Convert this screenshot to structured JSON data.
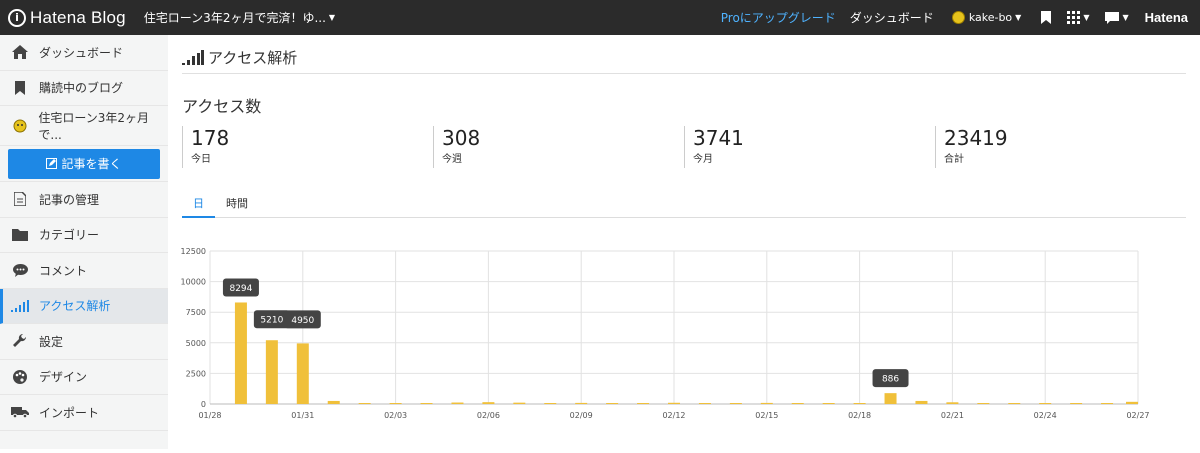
{
  "topbar": {
    "brand": "Hatena Blog",
    "blog_title": "住宅ローン3年2ヶ月で完済！ゆ...",
    "pro_link": "Proにアップグレード",
    "dashboard_link": "ダッシュボード",
    "username": "kake-bo",
    "hatena_logo": "Hatena"
  },
  "sidebar": {
    "items": [
      {
        "label": "ダッシュボード",
        "icon": "home-icon"
      },
      {
        "label": "購読中のブログ",
        "icon": "bookmark-icon"
      },
      {
        "label": "住宅ローン3年2ヶ月で...",
        "icon": "blog-avatar-icon"
      },
      {
        "label": "記事の管理",
        "icon": "document-icon"
      },
      {
        "label": "カテゴリー",
        "icon": "folder-icon"
      },
      {
        "label": "コメント",
        "icon": "comment-icon"
      },
      {
        "label": "アクセス解析",
        "icon": "signal-icon"
      },
      {
        "label": "設定",
        "icon": "wrench-icon"
      },
      {
        "label": "デザイン",
        "icon": "palette-icon"
      },
      {
        "label": "インポート",
        "icon": "truck-icon"
      }
    ],
    "write_button": "記事を書く"
  },
  "main": {
    "page_title": "アクセス解析",
    "section_title": "アクセス数",
    "stats": [
      {
        "value": "178",
        "label": "今日"
      },
      {
        "value": "308",
        "label": "今週"
      },
      {
        "value": "3741",
        "label": "今月"
      },
      {
        "value": "23419",
        "label": "合計"
      }
    ],
    "tabs": [
      "日",
      "時間"
    ],
    "active_tab": "日"
  },
  "colors": {
    "accent": "#1e88e5",
    "bar": "#f0c03a",
    "topbar": "#2b2b2b",
    "tooltip": "#444444"
  },
  "chart_data": {
    "type": "bar",
    "categories": [
      "01/28",
      "01/29",
      "01/30",
      "01/31",
      "02/01",
      "02/02",
      "02/03",
      "02/04",
      "02/05",
      "02/06",
      "02/07",
      "02/08",
      "02/09",
      "02/10",
      "02/11",
      "02/12",
      "02/13",
      "02/14",
      "02/15",
      "02/16",
      "02/17",
      "02/18",
      "02/19",
      "02/20",
      "02/21",
      "02/22",
      "02/23",
      "02/24",
      "02/25",
      "02/26",
      "02/27"
    ],
    "x_tick_labels": [
      "01/28",
      "01/31",
      "02/03",
      "02/06",
      "02/09",
      "02/12",
      "02/15",
      "02/18",
      "02/21",
      "02/24",
      "02/27"
    ],
    "values": [
      0,
      8294,
      5210,
      4950,
      250,
      40,
      60,
      80,
      120,
      150,
      110,
      60,
      90,
      80,
      70,
      100,
      80,
      60,
      90,
      50,
      70,
      80,
      886,
      250,
      140,
      60,
      50,
      40,
      60,
      60,
      178
    ],
    "data_labels": {
      "1": "8294",
      "2": "5210",
      "3": "4950",
      "22": "886"
    },
    "yticks": [
      0,
      2500,
      5000,
      7500,
      10000,
      12500
    ],
    "ylim": [
      0,
      12500
    ],
    "grid": true
  }
}
